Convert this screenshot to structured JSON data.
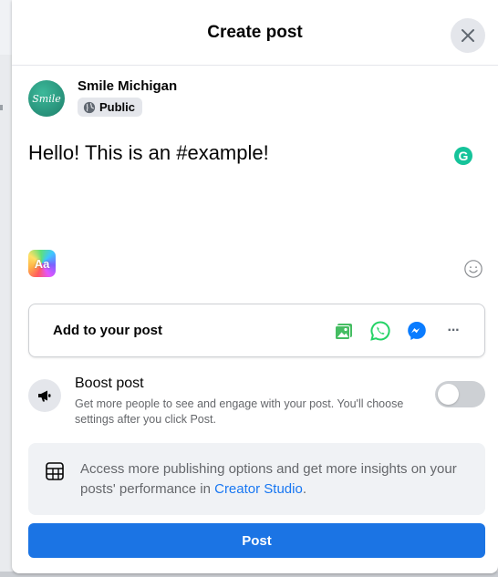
{
  "dialog": {
    "title": "Create post",
    "close_icon": "close-icon"
  },
  "author": {
    "avatar_text": "Smile",
    "name": "Smile Michigan",
    "audience": "Public",
    "audience_icon": "globe-icon"
  },
  "composer": {
    "text": "Hello! This is an #example!",
    "grammarly_label": "G",
    "background_picker_label": "Aa",
    "emoji_icon": "smiley-icon"
  },
  "add_to_post": {
    "label": "Add to your post",
    "icons": [
      "photo-video-icon",
      "whatsapp-icon",
      "messenger-icon",
      "more-icon"
    ],
    "more_label": "···"
  },
  "boost": {
    "title": "Boost post",
    "description": "Get more people to see and engage with your post. You'll choose settings after you click Post.",
    "enabled": false
  },
  "creator_studio": {
    "text": "Access more publishing options and get more insights on your posts' performance in ",
    "link": "Creator Studio",
    "suffix": "."
  },
  "post_button": {
    "label": "Post"
  },
  "colors": {
    "primary": "#1b74e4",
    "link": "#1877f2",
    "whatsapp": "#25d366",
    "photo": "#45bd62",
    "grammarly": "#15c39a"
  }
}
